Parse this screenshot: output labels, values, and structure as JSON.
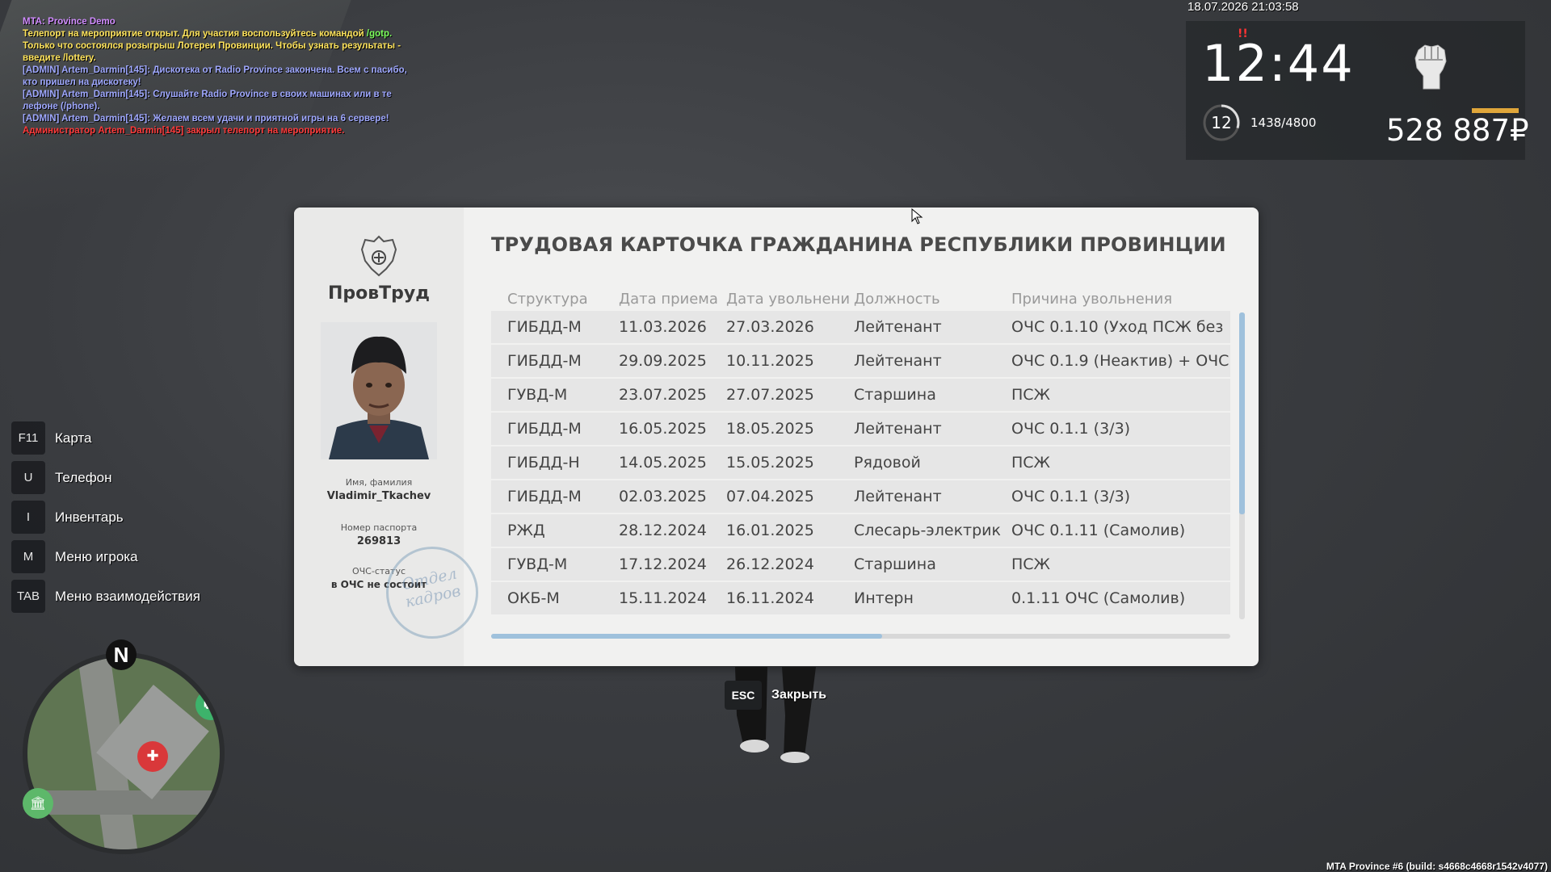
{
  "chat": {
    "lines": [
      {
        "text": "MTA: Province Demo"
      },
      {
        "text": "Телепорт на мероприятие открыт. Для участия воспользуйтесь командой ",
        "cmd": "/gotp."
      },
      {
        "text": "Только что состоялся розыгрыш Лотереи Провинции. Чтобы узнать результаты - введите /lottery."
      },
      {
        "text": "[ADMIN] Artem_Darmin[145]: Дискотека от Radio Province закончена. Всем с пасибо, кто пришел на дискотеку!"
      },
      {
        "text": "[ADMIN] Artem_Darmin[145]: Слушайте Radio Province в своих машинах или в те лефоне (/phone)."
      },
      {
        "text": "[ADMIN] Artem_Darmin[145]: Желаем всем удачи и приятной игры на 6 сервере!"
      },
      {
        "text": "Администратор Artem_Darmin[145] закрыл телепорт на мероприятие."
      }
    ]
  },
  "hud": {
    "datetime": "18.07.2026 21:03:58",
    "clock": "12:44",
    "level": "12",
    "xp": "1438/4800",
    "xp_fraction": 0.3,
    "money": "528 887₽",
    "hunger_marks": "!!",
    "colors": {
      "money_bar": "#e0a63a",
      "warning": "#ff3333"
    }
  },
  "hints": [
    {
      "key": "F11",
      "label": "Карта"
    },
    {
      "key": "U",
      "label": "Телефон"
    },
    {
      "key": "I",
      "label": "Инвентарь"
    },
    {
      "key": "M",
      "label": "Меню игрока"
    },
    {
      "key": "TAB",
      "label": "Меню взаимодействия"
    }
  ],
  "minimap": {
    "north": "N"
  },
  "card": {
    "brand": "ПровТруд",
    "title": "ТРУДОВАЯ КАРТОЧКА ГРАЖДАНИНА РЕСПУБЛИКИ ПРОВИНЦИИ",
    "name_label": "Имя, фамилия",
    "name": "Vladimir_Tkachev",
    "passport_label": "Номер паспорта",
    "passport": "269813",
    "ochs_label": "ОЧС-статус",
    "ochs_value": "в ОЧС не состоит",
    "stamp_line1": "Отдел",
    "stamp_line2": "кадров",
    "columns": [
      "Структура",
      "Дата приема",
      "Дата увольнени",
      "Должность",
      "Причина увольнения"
    ],
    "rows": [
      [
        "ГИБДД-М",
        "11.03.2026",
        "27.03.2026",
        "Лейтенант",
        "ОЧС 0.1.10 (Уход ПСЖ без"
      ],
      [
        "ГИБДД-М",
        "29.09.2025",
        "10.11.2025",
        "Лейтенант",
        "ОЧС 0.1.9 (Неактив) + ОЧС"
      ],
      [
        "ГУВД-М",
        "23.07.2025",
        "27.07.2025",
        "Старшина",
        "ПСЖ"
      ],
      [
        "ГИБДД-М",
        "16.05.2025",
        "18.05.2025",
        "Лейтенант",
        "ОЧС 0.1.1 (3/3)"
      ],
      [
        "ГИБДД-Н",
        "14.05.2025",
        "15.05.2025",
        "Рядовой",
        "ПСЖ"
      ],
      [
        "ГИБДД-М",
        "02.03.2025",
        "07.04.2025",
        "Лейтенант",
        "ОЧС 0.1.1 (3/3)"
      ],
      [
        "РЖД",
        "28.12.2024",
        "16.01.2025",
        "Слесарь-электрик",
        "ОЧС 0.1.11 (Самолив)"
      ],
      [
        "ГУВД-М",
        "17.12.2024",
        "26.12.2024",
        "Старшина",
        "ПСЖ"
      ],
      [
        "ОКБ-М",
        "15.11.2024",
        "16.11.2024",
        "Интерн",
        "0.1.11 ОЧС (Самолив)"
      ]
    ]
  },
  "close": {
    "key": "ESC",
    "label": "Закрыть"
  },
  "build": "MTA Province #6 (build: s4668c4668r1542v4077)"
}
